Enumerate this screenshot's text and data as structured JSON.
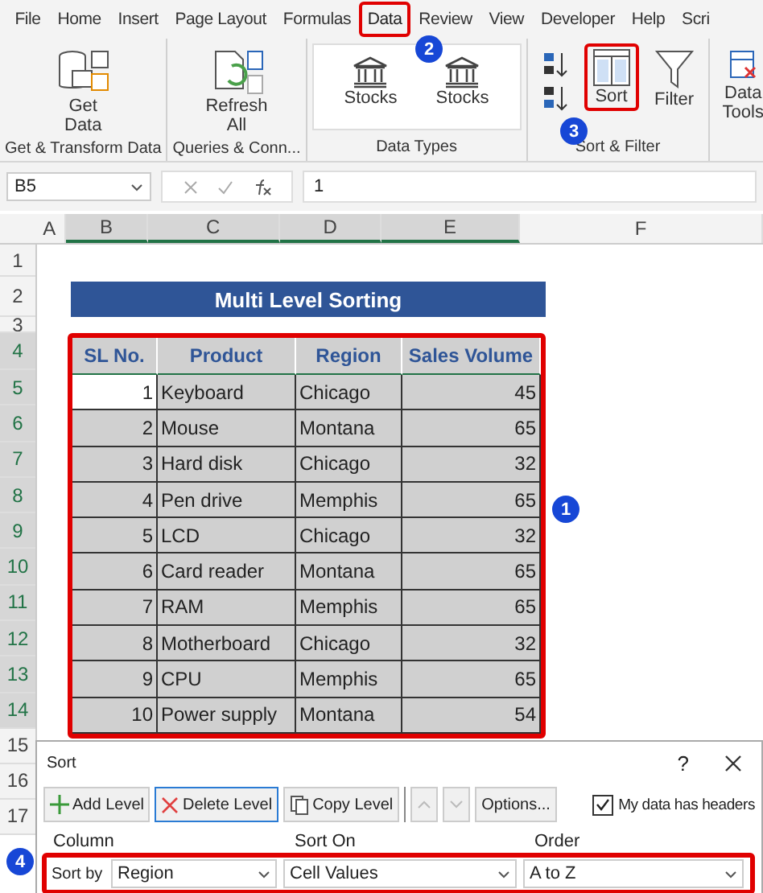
{
  "ribbon_tabs": [
    {
      "label": "File",
      "selected": false
    },
    {
      "label": "Home",
      "selected": false
    },
    {
      "label": "Insert",
      "selected": false
    },
    {
      "label": "Page Layout",
      "selected": false
    },
    {
      "label": "Formulas",
      "selected": false
    },
    {
      "label": "Data",
      "selected": true
    },
    {
      "label": "Review",
      "selected": false
    },
    {
      "label": "View",
      "selected": false
    },
    {
      "label": "Developer",
      "selected": false
    },
    {
      "label": "Help",
      "selected": false
    },
    {
      "label": "Scri",
      "selected": false
    }
  ],
  "ribbon_groups": [
    {
      "label": "Get & Transform Data",
      "buttons": [
        {
          "kind": "getdata",
          "label": "Get",
          "label2": "Data",
          "highlighted": false
        }
      ]
    },
    {
      "label": "Queries & Conn...",
      "buttons": [
        {
          "kind": "refresh",
          "label": "Refresh",
          "label2": "All",
          "highlighted": false
        }
      ]
    },
    {
      "label": "Data Types",
      "buttons": [
        {
          "kind": "stocks",
          "label": "Stocks",
          "highlighted": false
        },
        {
          "kind": "stocks",
          "label": "Stocks",
          "highlighted": false
        }
      ]
    },
    {
      "label": "Sort & Filter",
      "buttons": [
        {
          "kind": "sortaz",
          "highlighted": false
        },
        {
          "kind": "sort",
          "label": "Sort",
          "highlighted": true
        },
        {
          "kind": "filter",
          "label": "Filter",
          "highlighted": false
        }
      ]
    },
    {
      "buttons": [
        {
          "kind": "tools",
          "label": "Data",
          "label2": "Tools",
          "highlighted": false
        }
      ]
    }
  ],
  "name_box": "B5",
  "formula": "1",
  "column_headers": [
    {
      "label": "A",
      "selected": false
    },
    {
      "label": "B",
      "selected": true
    },
    {
      "label": "C",
      "selected": true
    },
    {
      "label": "D",
      "selected": true
    },
    {
      "label": "E",
      "selected": true
    },
    {
      "label": "F",
      "selected": false
    }
  ],
  "row_headers": [
    {
      "label": "1",
      "selected": false
    },
    {
      "label": "2",
      "selected": false
    },
    {
      "label": "3",
      "selected": false
    },
    {
      "label": "4",
      "selected": true
    },
    {
      "label": "5",
      "selected": true
    },
    {
      "label": "6",
      "selected": true
    },
    {
      "label": "7",
      "selected": true
    },
    {
      "label": "8",
      "selected": true
    },
    {
      "label": "9",
      "selected": true
    },
    {
      "label": "10",
      "selected": true
    },
    {
      "label": "11",
      "selected": true
    },
    {
      "label": "12",
      "selected": true
    },
    {
      "label": "13",
      "selected": true
    },
    {
      "label": "14",
      "selected": true
    },
    {
      "label": "15",
      "selected": false
    },
    {
      "label": "16",
      "selected": false
    },
    {
      "label": "17",
      "selected": false
    }
  ],
  "sheet_title": "Multi Level Sorting",
  "table": {
    "columns": [
      "SL No.",
      "Product",
      "Region",
      "Sales Volume"
    ],
    "rows": [
      [
        {
          "text": "1",
          "selected": true
        },
        {
          "text": "Keyboard",
          "selected": false
        },
        {
          "text": "Chicago",
          "selected": false
        },
        {
          "text": "45",
          "selected": false
        }
      ],
      [
        {
          "text": "2",
          "selected": false
        },
        {
          "text": "Mouse",
          "selected": false
        },
        {
          "text": "Montana",
          "selected": false
        },
        {
          "text": "65",
          "selected": false
        }
      ],
      [
        {
          "text": "3",
          "selected": false
        },
        {
          "text": "Hard disk",
          "selected": false
        },
        {
          "text": "Chicago",
          "selected": false
        },
        {
          "text": "32",
          "selected": false
        }
      ],
      [
        {
          "text": "4",
          "selected": false
        },
        {
          "text": "Pen drive",
          "selected": false
        },
        {
          "text": "Memphis",
          "selected": false
        },
        {
          "text": "65",
          "selected": false
        }
      ],
      [
        {
          "text": "5",
          "selected": false
        },
        {
          "text": "LCD",
          "selected": false
        },
        {
          "text": "Chicago",
          "selected": false
        },
        {
          "text": "32",
          "selected": false
        }
      ],
      [
        {
          "text": "6",
          "selected": false
        },
        {
          "text": "Card reader",
          "selected": false
        },
        {
          "text": "Montana",
          "selected": false
        },
        {
          "text": "65",
          "selected": false
        }
      ],
      [
        {
          "text": "7",
          "selected": false
        },
        {
          "text": "RAM",
          "selected": false
        },
        {
          "text": "Memphis",
          "selected": false
        },
        {
          "text": "65",
          "selected": false
        }
      ],
      [
        {
          "text": "8",
          "selected": false
        },
        {
          "text": "Motherboard",
          "selected": false
        },
        {
          "text": "Chicago",
          "selected": false
        },
        {
          "text": "32",
          "selected": false
        }
      ],
      [
        {
          "text": "9",
          "selected": false
        },
        {
          "text": "CPU",
          "selected": false
        },
        {
          "text": "Memphis",
          "selected": false
        },
        {
          "text": "65",
          "selected": false
        }
      ],
      [
        {
          "text": "10",
          "selected": false
        },
        {
          "text": "Power supply",
          "selected": false
        },
        {
          "text": "Montana",
          "selected": false
        },
        {
          "text": "54",
          "selected": false
        }
      ]
    ]
  },
  "dialog": {
    "title": "Sort",
    "help": "?",
    "buttons": [
      {
        "kind": "add",
        "label": "Add Level",
        "disabled": false
      },
      {
        "kind": "delete",
        "label": "Delete Level",
        "disabled": false
      },
      {
        "kind": "copy",
        "label": "Copy Level",
        "disabled": false
      },
      {
        "kind": "up",
        "disabled": true
      },
      {
        "kind": "down",
        "disabled": true
      },
      {
        "kind": "text",
        "label": "Options...",
        "disabled": false
      }
    ],
    "headers_checkbox": {
      "label": "My data has headers",
      "checked": true
    },
    "columns": [
      "Column",
      "Sort On",
      "Order"
    ],
    "level": {
      "label": "Sort by",
      "column": "Region",
      "sort_on": "Cell Values",
      "order": "A to Z"
    }
  },
  "callouts": [
    "1",
    "2",
    "3",
    "4"
  ]
}
